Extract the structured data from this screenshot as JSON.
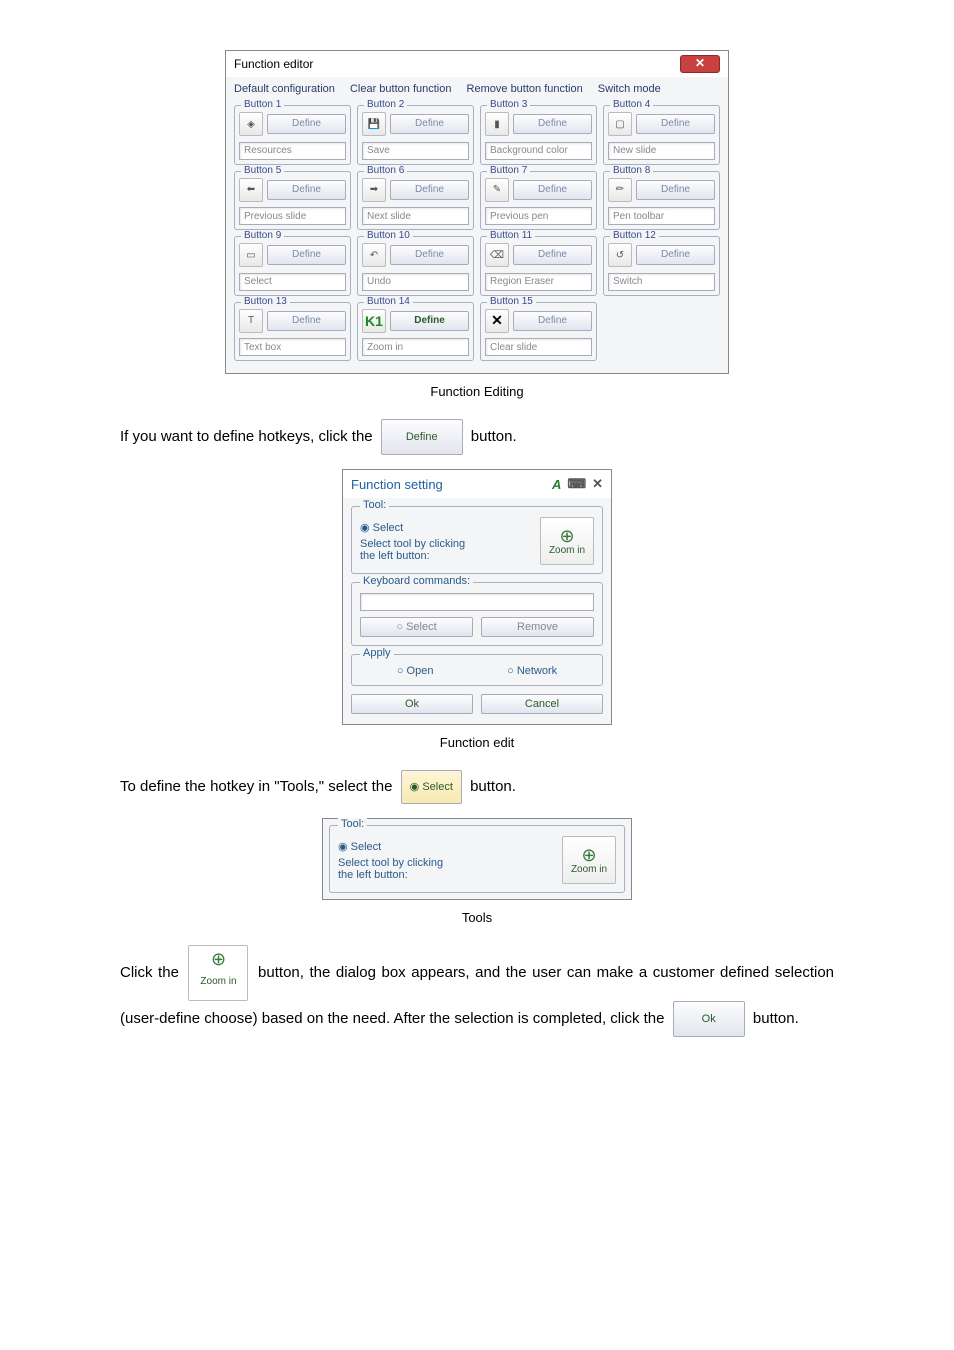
{
  "editor": {
    "title": "Function editor",
    "menu": [
      "Default configuration",
      "Clear button function",
      "Remove button function",
      "Switch mode"
    ],
    "buttons": [
      {
        "label": "Button 1",
        "def": "Define",
        "field": "Resources",
        "active": false,
        "icon": "◈"
      },
      {
        "label": "Button 2",
        "def": "Define",
        "field": "Save",
        "active": false,
        "icon": "💾"
      },
      {
        "label": "Button 3",
        "def": "Define",
        "field": "Background color",
        "active": false,
        "icon": "▮"
      },
      {
        "label": "Button 4",
        "def": "Define",
        "field": "New slide",
        "active": false,
        "icon": "▢"
      },
      {
        "label": "Button 5",
        "def": "Define",
        "field": "Previous slide",
        "active": false,
        "icon": "⬅"
      },
      {
        "label": "Button 6",
        "def": "Define",
        "field": "Next slide",
        "active": false,
        "icon": "➡"
      },
      {
        "label": "Button 7",
        "def": "Define",
        "field": "Previous pen",
        "active": false,
        "icon": "✎"
      },
      {
        "label": "Button 8",
        "def": "Define",
        "field": "Pen toolbar",
        "active": false,
        "icon": "✏"
      },
      {
        "label": "Button 9",
        "def": "Define",
        "field": "Select",
        "active": false,
        "icon": "▭"
      },
      {
        "label": "Button 10",
        "def": "Define",
        "field": "Undo",
        "active": false,
        "icon": "↶"
      },
      {
        "label": "Button 11",
        "def": "Define",
        "field": "Region Eraser",
        "active": false,
        "icon": "⌫"
      },
      {
        "label": "Button 12",
        "def": "Define",
        "field": "Switch",
        "active": false,
        "icon": "↺"
      },
      {
        "label": "Button 13",
        "def": "Define",
        "field": "Text box",
        "active": false,
        "icon": "T"
      },
      {
        "label": "Button 14",
        "def": "Define",
        "field": "Zoom in",
        "active": true,
        "icon": "K1",
        "k1": true
      },
      {
        "label": "Button 15",
        "def": "Define",
        "field": "Clear slide",
        "active": false,
        "icon": "✕",
        "x": true
      }
    ]
  },
  "caption1": "Function Editing",
  "para1a": "If you want to define hotkeys, click the ",
  "para1b": " button.",
  "defineBtn": "Define",
  "fs": {
    "title": "Function setting",
    "toolLabel": "Tool:",
    "select": "Select",
    "hint": "Select tool by clicking\nthe left button:",
    "zoom": "Zoom in",
    "kbLabel": "Keyboard commands:",
    "selectBtn": "Select",
    "removeBtn": "Remove",
    "applyLabel": "Apply",
    "open": "Open",
    "network": "Network",
    "ok": "Ok",
    "cancel": "Cancel"
  },
  "caption2": "Function edit",
  "para2a": "To define the hotkey in \"Tools,\" select the ",
  "para2b": " button.",
  "selectInline": "Select",
  "caption3": "Tools",
  "para3a": "Click the ",
  "para3b": " button, the dialog box appears, and the user can make a customer defined selection (user-define choose) based on the need. After the selection is completed, click the ",
  "para3c": " button.",
  "zoomInline": "Zoom in",
  "okInline": "Ok"
}
